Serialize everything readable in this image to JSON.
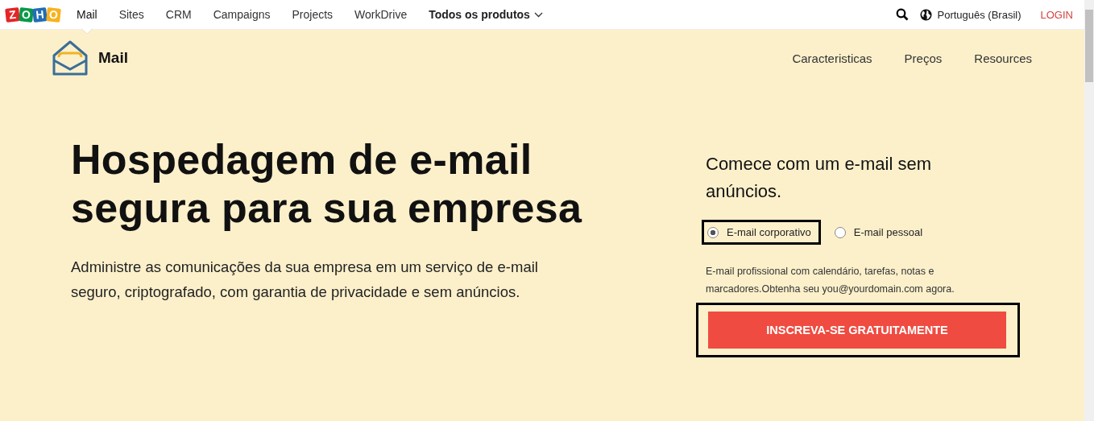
{
  "logo": {
    "letters": [
      {
        "text": "Z",
        "color": "#e42527"
      },
      {
        "text": "O",
        "color": "#089949"
      },
      {
        "text": "H",
        "color": "#226db4"
      },
      {
        "text": "O",
        "color": "#f9b21d"
      }
    ]
  },
  "top_nav": [
    {
      "label": "Mail",
      "selected": true
    },
    {
      "label": "Sites",
      "selected": false
    },
    {
      "label": "CRM",
      "selected": false
    },
    {
      "label": "Campaigns",
      "selected": false
    },
    {
      "label": "Projects",
      "selected": false
    },
    {
      "label": "WorkDrive",
      "selected": false
    },
    {
      "label": "Todos os produtos",
      "selected": false,
      "kind": "dropdown"
    }
  ],
  "language": "Português (Brasil)",
  "login": "LOGIN",
  "product": {
    "name": "Mail",
    "nav": [
      "Caracteristicas",
      "Preços",
      "Resources"
    ]
  },
  "hero": {
    "title": "Hospedagem de e-mail segura para sua empresa",
    "description": "Administre as comunicações da sua empresa em um serviço de e-mail seguro, criptografado, com garantia de privacidade e sem anúncios."
  },
  "signup": {
    "title": "Comece com um e-mail sem anúncios.",
    "options": [
      {
        "label": "E-mail corporativo",
        "selected": true,
        "highlighted": true
      },
      {
        "label": "E-mail pessoal",
        "selected": false,
        "highlighted": false
      }
    ],
    "note": "E-mail profissional com calendário, tarefas, notas e marcadores.Obtenha seu you@yourdomain.com agora.",
    "button": {
      "label": "INSCREVA-SE GRATUITAMENTE",
      "highlighted": true
    }
  }
}
